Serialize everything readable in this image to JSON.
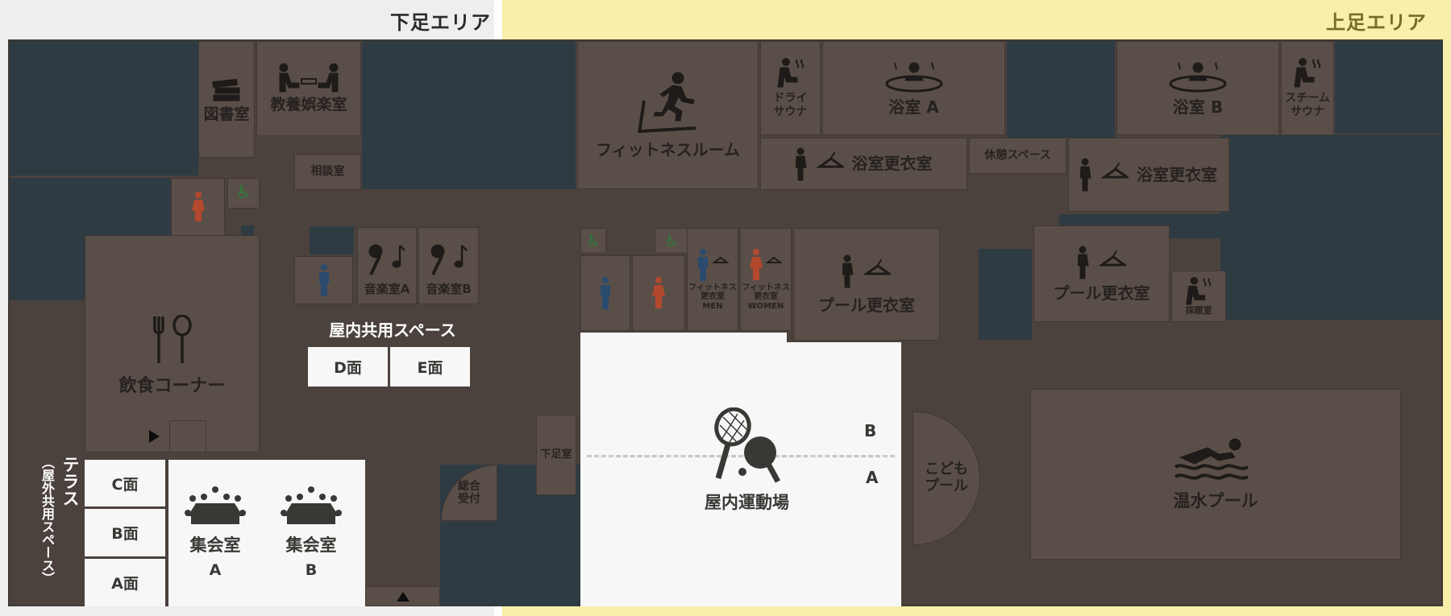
{
  "zones": {
    "left_title": "下足エリア",
    "right_title": "上足エリア",
    "left_bg": "#eeeeee",
    "right_bg": "#f9eeaa",
    "right_title_color": "#7a6a2a"
  },
  "colors": {
    "room": "#5a4f48",
    "void": "#2f3b42",
    "floor": "#4b423d",
    "white_room": "#f7f7f7",
    "male": "#2b4b6e",
    "female": "#b2482d",
    "accessible": "#2e7a3a"
  },
  "rooms": {
    "library": "図書室",
    "culture": "教養娯楽室",
    "consult": "相談室",
    "fitness": "フィットネスルーム",
    "dry_sauna": "ドライ\nサウナ",
    "bath_a": "浴室 A",
    "bath_b": "浴室 B",
    "steam_sauna": "スチーム\nサウナ",
    "bath_changing_1": "浴室更衣室",
    "bath_changing_2": "浴室更衣室",
    "rest": "休憩スペース",
    "music_a": "音楽室A",
    "music_b": "音楽室B",
    "fitness_changing_men": "フィットネス\n更衣室\nMEN",
    "fitness_changing_women": "フィットネス\n更衣室\nWOMEN",
    "pool_changing_1": "プール更衣室",
    "pool_changing_2": "プール更衣室",
    "warm_room": "採暖室",
    "dining": "飲食コーナー",
    "indoor_shared": "屋内共用スペース",
    "face_d": "D面",
    "face_e": "E面",
    "shoe_area": "下足室",
    "reception": "総合\n受付",
    "gym": "屋内運動場",
    "gym_b": "B",
    "gym_a": "A",
    "kids_pool": "こども\nプール",
    "warm_pool": "温水プール",
    "terrace": "テラス",
    "terrace_sub": "（屋外共用スペース）",
    "face_c": "C面",
    "face_b": "B面",
    "face_a": "A面",
    "meeting_a": "集会室",
    "meeting_a_sub": "A",
    "meeting_b": "集会室",
    "meeting_b_sub": "B"
  },
  "icons": [
    "books-icon",
    "reading-people-icon",
    "treadmill-runner-icon",
    "sauna-person-icon",
    "hot-bath-icon",
    "female-person-icon",
    "male-person-icon",
    "wheelchair-icon",
    "microphone-note-icon",
    "hanger-icon",
    "fork-spoon-icon",
    "racket-ball-icon",
    "swimmer-icon",
    "meeting-table-icon",
    "entrance-arrow-icon"
  ]
}
